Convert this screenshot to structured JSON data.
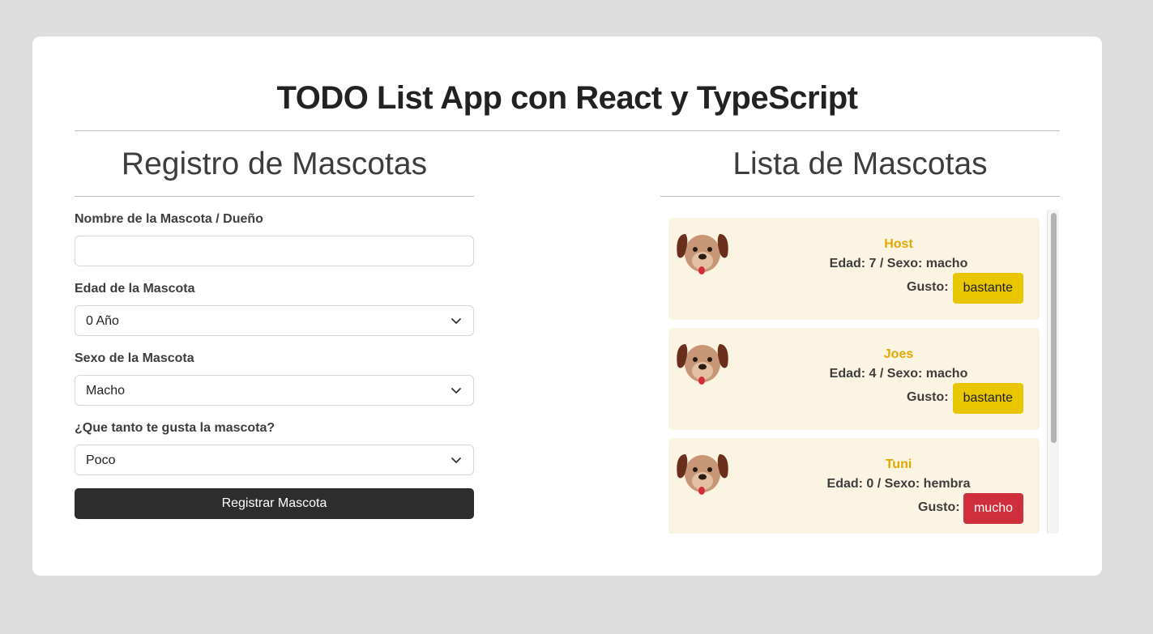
{
  "app": {
    "title": "TODO List App con React y TypeScript"
  },
  "form": {
    "title": "Registro de Mascotas",
    "name_label": "Nombre de la Mascota / Dueño",
    "name_value": "",
    "age_label": "Edad de la Mascota",
    "age_value": "0 Año",
    "sex_label": "Sexo de la Mascota",
    "sex_value": "Macho",
    "like_label": "¿Que tanto te gusta la mascota?",
    "like_value": "Poco",
    "submit_label": "Registrar Mascota"
  },
  "list": {
    "title": "Lista de Mascotas",
    "gusto_label": "Gusto:",
    "pets": [
      {
        "name": "Host",
        "info": "Edad: 7 / Sexo: macho",
        "gusto": "bastante",
        "badge_color": "#e8c700",
        "badge_text_color": "#1f1f1f"
      },
      {
        "name": "Joes",
        "info": "Edad: 4 / Sexo: macho",
        "gusto": "bastante",
        "badge_color": "#e8c700",
        "badge_text_color": "#1f1f1f"
      },
      {
        "name": "Tuni",
        "info": "Edad: 0 / Sexo: hembra",
        "gusto": "mucho",
        "badge_color": "#cf2e3d",
        "badge_text_color": "#ffffff"
      }
    ]
  },
  "colors": {
    "background": "#dddddd",
    "card": "#ffffff",
    "pet_card": "#fbf4e2",
    "pet_name": "#e3a800",
    "button": "#2d2d2d"
  },
  "icons": {
    "avatar": "dog-face-icon",
    "select_arrow": "chevron-down-icon"
  }
}
